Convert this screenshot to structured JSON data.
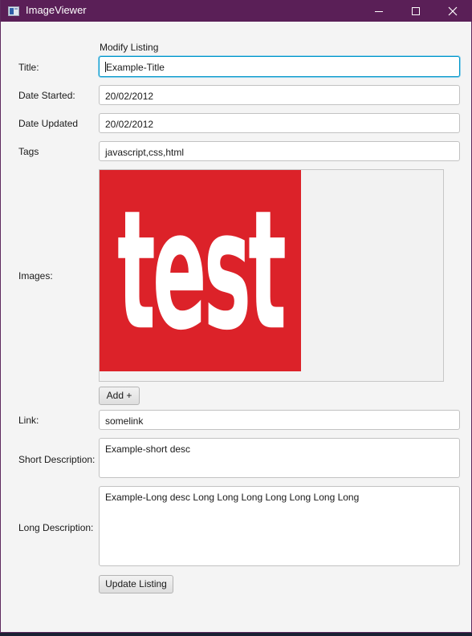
{
  "window": {
    "title": "ImageViewer"
  },
  "form": {
    "heading": "Modify Listing",
    "title": {
      "label": "Title:",
      "value": "Example-Title"
    },
    "date_started": {
      "label": "Date Started:",
      "value": "20/02/2012"
    },
    "date_updated": {
      "label": "Date Updated",
      "value": "20/02/2012"
    },
    "tags": {
      "label": "Tags",
      "value": "javascript,css,html"
    },
    "images": {
      "label": "Images:",
      "thumbnail_text": "test",
      "add_label": "Add +"
    },
    "link": {
      "label": "Link:",
      "value": "somelink"
    },
    "short_description": {
      "label": "Short Description:",
      "value": "Example-short desc"
    },
    "long_description": {
      "label": "Long Description:",
      "value": "Example-Long desc Long Long Long Long Long Long Long"
    },
    "update_label": "Update Listing"
  },
  "colors": {
    "titlebar": "#5a1f57",
    "focus": "#0096c9",
    "thumbnail_bg": "#dc2229"
  },
  "icons": [
    "app-window-icon",
    "minimize-icon",
    "maximize-icon",
    "close-icon"
  ]
}
